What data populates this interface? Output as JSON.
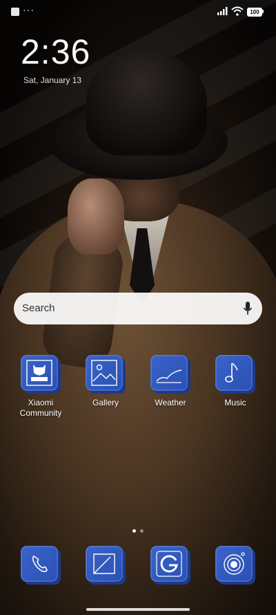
{
  "status_bar": {
    "battery": "100",
    "icons": [
      "notification-square-icon",
      "more-dots-icon",
      "signal-icon",
      "wifi-icon",
      "battery-icon"
    ]
  },
  "clock": {
    "time": "2:36",
    "date": "Sat, January 13"
  },
  "search": {
    "placeholder": "Search",
    "icon": "mic-icon"
  },
  "apps": [
    {
      "label": "Xiaomi Community",
      "icon": "xiaomi-community-icon"
    },
    {
      "label": "Gallery",
      "icon": "gallery-icon"
    },
    {
      "label": "Weather",
      "icon": "weather-icon"
    },
    {
      "label": "Music",
      "icon": "music-icon"
    }
  ],
  "dock": [
    {
      "icon": "phone-icon"
    },
    {
      "icon": "messages-icon"
    },
    {
      "icon": "google-icon"
    },
    {
      "icon": "camera-icon"
    }
  ],
  "page_indicator": {
    "pages": 2,
    "active": 1
  },
  "colors": {
    "icon_front": "#3b64c9",
    "icon_back": "#1c3a8c",
    "search_bg": "#ffffff"
  }
}
